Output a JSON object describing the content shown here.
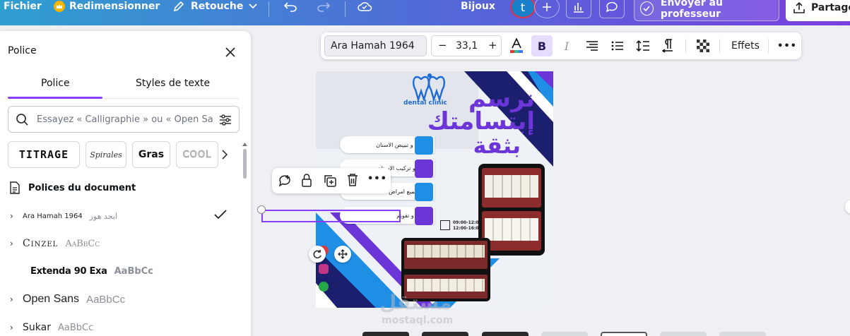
{
  "topbar": {
    "file_label": "Fichier",
    "resize_label": "Redimensionner",
    "retouch_label": "Retouche",
    "project_name": "Bijoux",
    "avatar_letter": "t",
    "send_label": "Envoyer au professeur",
    "share_label": "Partage",
    "crown_color": "#f5b400"
  },
  "panel": {
    "title": "Police",
    "tabs": [
      "Police",
      "Styles de texte"
    ],
    "search_placeholder": "Essayez « Calligraphie » ou « Open Sa",
    "chips": [
      "TITRAGE",
      "Spirales",
      "Gras",
      "COOL"
    ],
    "section_title": "Polices du document",
    "fonts": [
      {
        "name": "Ara Hamah 1964",
        "sample": "ابجد هوز",
        "selected": true
      },
      {
        "name": "Cinzel",
        "sample": "AaBbCc"
      },
      {
        "name": "Extenda 90 Exa",
        "sample": "AaBbCc"
      },
      {
        "name": "Open Sans",
        "sample": "AaBbCc"
      },
      {
        "name": "Sukar",
        "sample": "AaBbCc"
      }
    ]
  },
  "toolbar": {
    "font_name": "Ara Hamah 1964",
    "font_size": "33,1",
    "minus": "−",
    "plus": "+",
    "bold": "B",
    "italic": "I",
    "effects_label": "Effets",
    "more": "•••",
    "accent": "#8b3dff"
  },
  "design": {
    "clinic_name": "dental clinic",
    "headline": [
      "نرسم",
      "إبتسامتك",
      "بثقة"
    ],
    "services": [
      "تنظيف و تبييض الاسنان",
      "ترميم و تركيب الاسنان",
      "علاج جميع امراض اللثة",
      "جراحة و تقويم"
    ],
    "hours": [
      "09:00-12:00",
      "12:00-16:00"
    ],
    "colors": {
      "blue": "#1f8fe6",
      "purple": "#6b35d8",
      "navy": "#1b1f6e"
    }
  },
  "floating_toolbar": {
    "more": "•••"
  },
  "watermark": {
    "arabic": "مستقل",
    "latin": "mostaql.com"
  }
}
